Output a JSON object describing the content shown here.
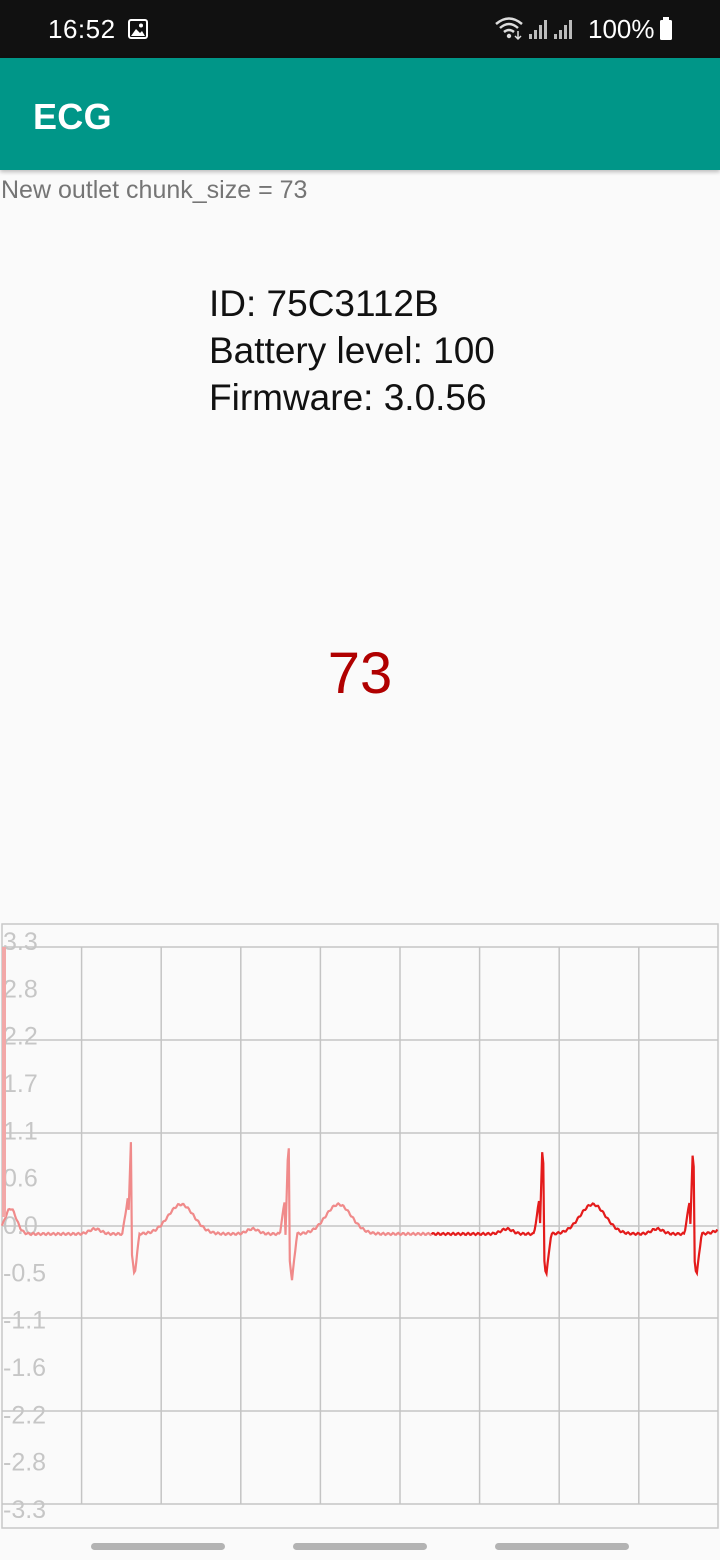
{
  "status_bar": {
    "time": "16:52",
    "battery_percent": "100%"
  },
  "app_bar": {
    "title": "ECG"
  },
  "log": {
    "message": "New outlet chunk_size = 73"
  },
  "device": {
    "id_line": "ID: 75C3112B",
    "battery_line": "Battery level: 100",
    "firmware_line": "Firmware: 3.0.56"
  },
  "heart_rate": {
    "value": "73",
    "color": "#b00000"
  },
  "chart_data": {
    "type": "line",
    "y_tick_labels": [
      "3.3",
      "2.8",
      "2.2",
      "1.7",
      "1.1",
      "0.6",
      "0.0",
      "-0.5",
      "-1.1",
      "-1.6",
      "-2.2",
      "-2.8",
      "-3.3"
    ],
    "ylim": [
      -3.3,
      3.3
    ],
    "grid": true,
    "trace_colors": {
      "faded": "#f08a8a",
      "recent": "#e41b1b"
    },
    "baseline": -0.1,
    "r_peaks": [
      {
        "t": 0.18,
        "peak": 1.0,
        "trough": -0.6
      },
      {
        "t": 0.4,
        "peak": 1.05,
        "trough": -0.65
      },
      {
        "t": 0.755,
        "peak": 1.0,
        "trough": -0.6
      },
      {
        "t": 0.965,
        "peak": 0.95,
        "trough": -0.6
      }
    ]
  }
}
